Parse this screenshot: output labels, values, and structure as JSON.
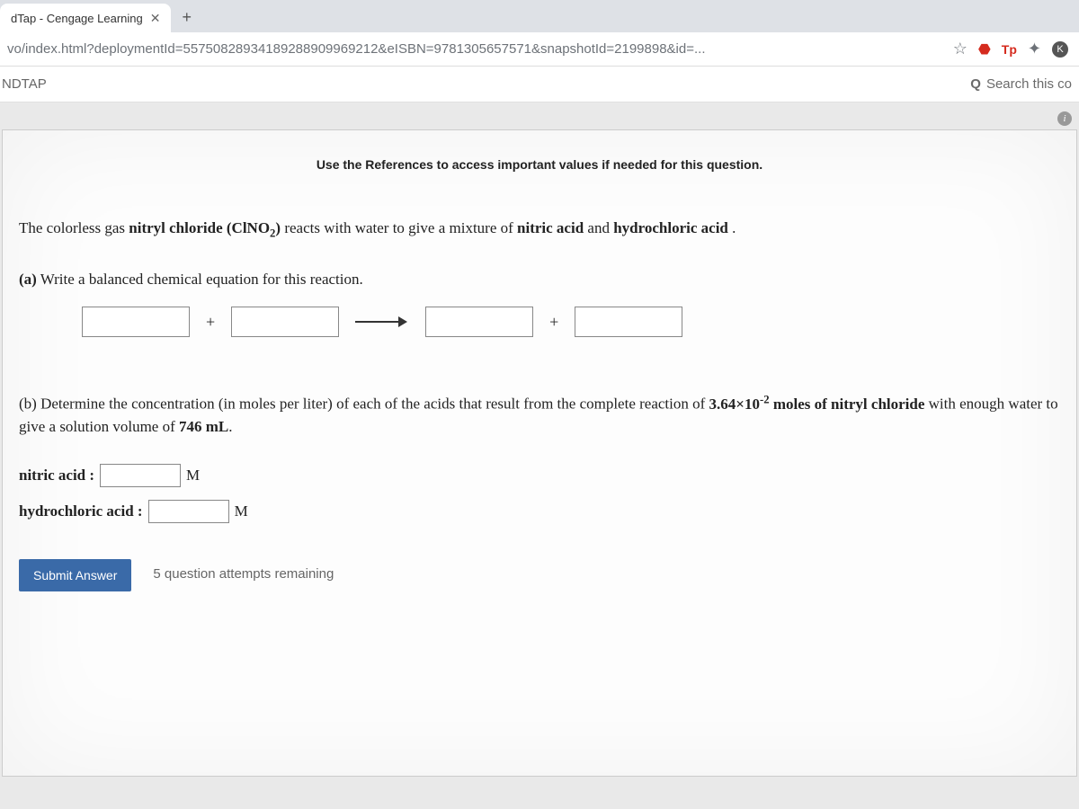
{
  "browser": {
    "tab_title": "dTap - Cengage Learning",
    "url": "vo/index.html?deploymentId=55750828934189288909969212&eISBN=9781305657571&snapshotId=2199898&id=...",
    "tp_label": "Tp",
    "k_label": "K"
  },
  "app": {
    "title": "NDTAP",
    "search_label": "Search this co"
  },
  "question": {
    "references_hint": "Use the References to access important values if needed for this question.",
    "intro_pre": "The colorless gas ",
    "intro_compound": "nitryl chloride (ClNO",
    "intro_sub": "2",
    "intro_after_sub": ")",
    "intro_mid": " reacts with water to give a mixture of ",
    "acid1": "nitric acid",
    "intro_and": " and ",
    "acid2": "hydrochloric acid",
    "intro_end": " .",
    "part_a_label": "(a)",
    "part_a_text": " Write a balanced chemical equation for this reaction.",
    "plus": "+",
    "part_b_pre": "(b) Determine the concentration (in moles per liter) of each of the acids that result from the complete reaction of ",
    "part_b_value": "3.64×10",
    "part_b_exp": "-2",
    "part_b_mid": " moles of nitryl chloride",
    "part_b_post": " with enough water to give a solution volume of ",
    "part_b_volume": "746 mL",
    "part_b_end": ".",
    "nitric_label": "nitric acid :",
    "hcl_label": "hydrochloric acid :",
    "unit": "M",
    "submit_label": "Submit Answer",
    "attempts": "5 question attempts remaining"
  }
}
